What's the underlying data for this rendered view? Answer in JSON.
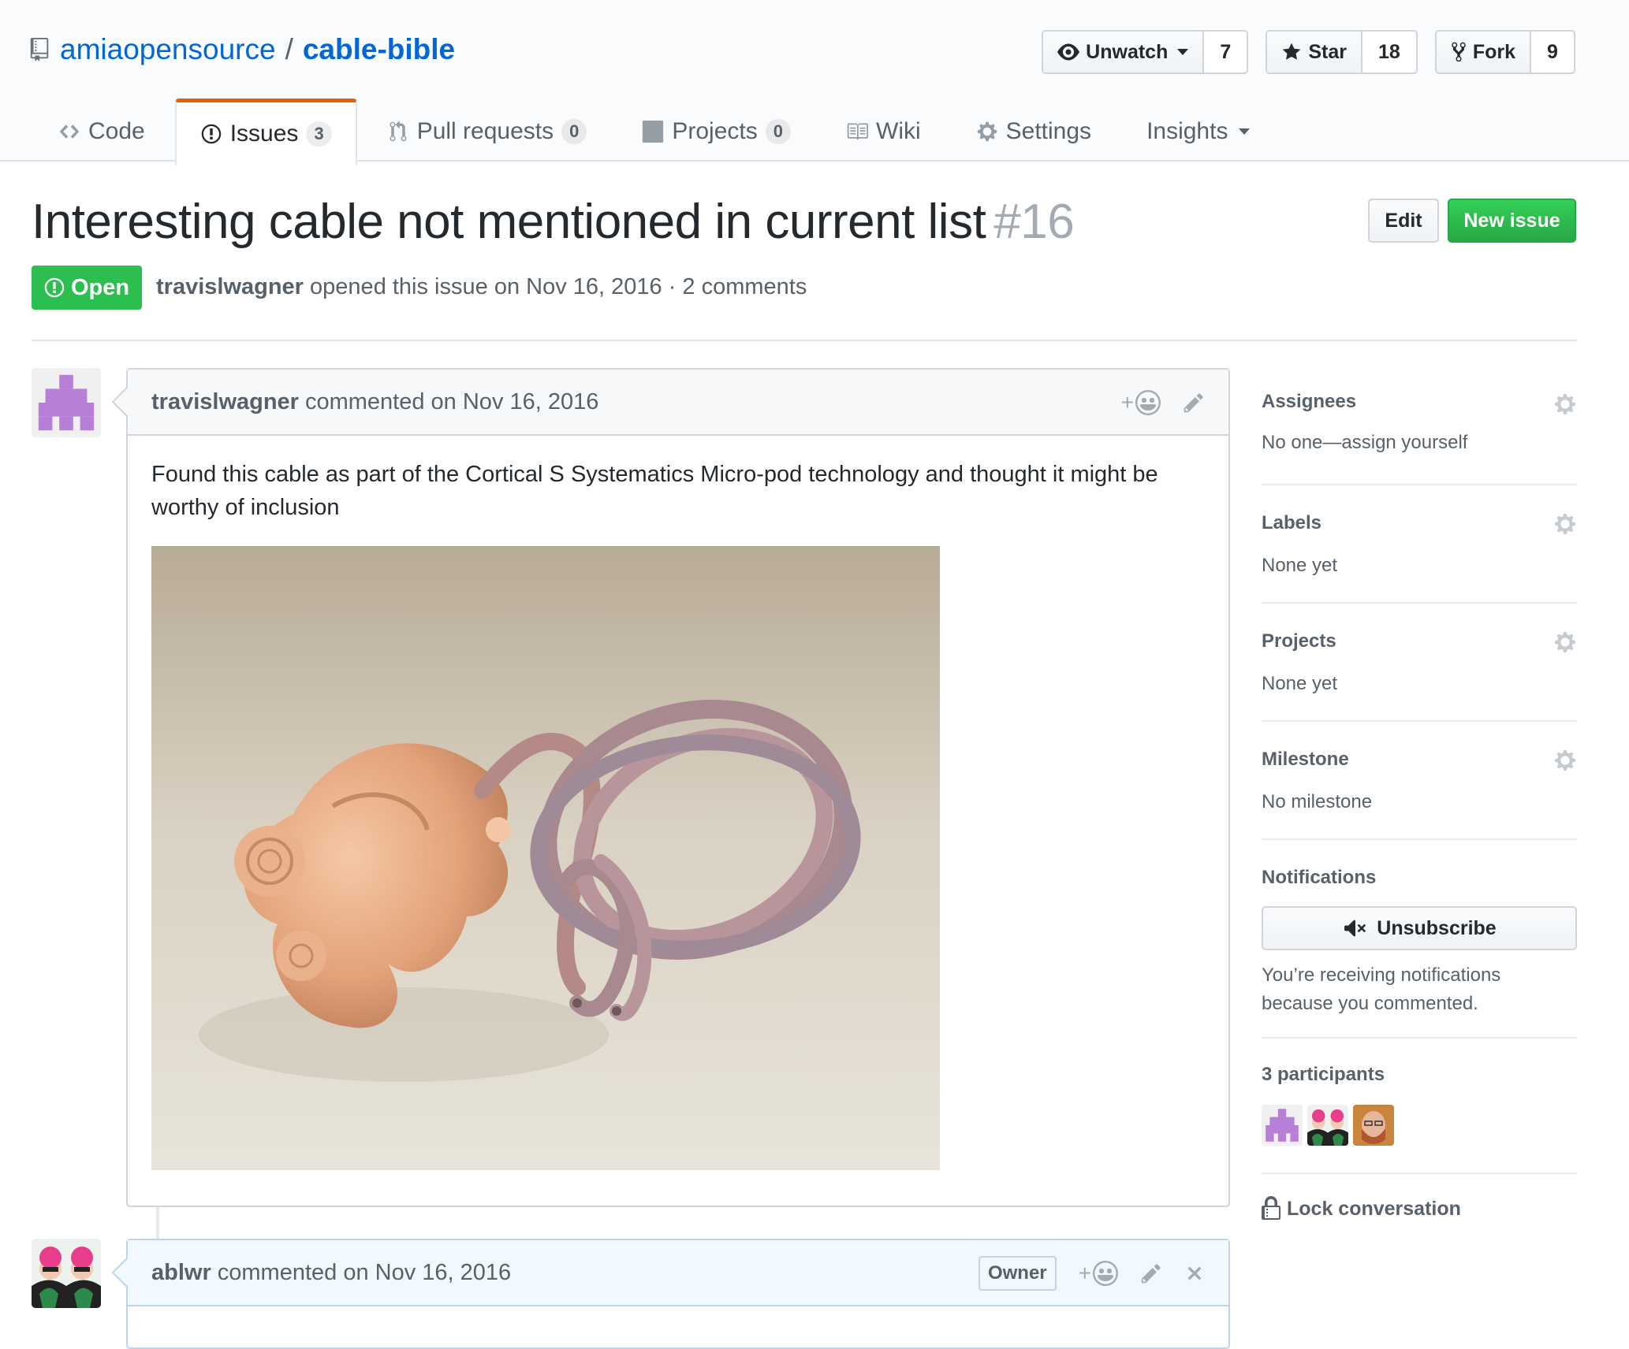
{
  "repo": {
    "owner": "amiaopensource",
    "separator": "/",
    "name": "cable-bible"
  },
  "actions": {
    "watch": {
      "label": "Unwatch",
      "count": "7"
    },
    "star": {
      "label": "Star",
      "count": "18"
    },
    "fork": {
      "label": "Fork",
      "count": "9"
    }
  },
  "nav": {
    "code": "Code",
    "issues": {
      "label": "Issues",
      "count": "3"
    },
    "pulls": {
      "label": "Pull requests",
      "count": "0"
    },
    "projects": {
      "label": "Projects",
      "count": "0"
    },
    "wiki": "Wiki",
    "settings": "Settings",
    "insights": "Insights"
  },
  "issue": {
    "title": "Interesting cable not mentioned in current list",
    "number": "#16",
    "state": "Open",
    "author": "travislwagner",
    "meta_text": "opened this issue on Nov 16, 2016 · 2 comments",
    "edit_label": "Edit",
    "new_issue_label": "New issue"
  },
  "comments": [
    {
      "author": "travislwagner",
      "meta": "commented on Nov 16, 2016",
      "body": "Found this cable as part of the Cortical S Systematics Micro-pod technology and thought it might be worthy of inclusion",
      "add_reaction": "+"
    },
    {
      "author": "ablwr",
      "meta": "commented on Nov 16, 2016",
      "badge": "Owner",
      "add_reaction": "+"
    }
  ],
  "sidebar": {
    "assignees": {
      "heading": "Assignees",
      "value": "No one—assign yourself"
    },
    "labels": {
      "heading": "Labels",
      "value": "None yet"
    },
    "projects": {
      "heading": "Projects",
      "value": "None yet"
    },
    "milestone": {
      "heading": "Milestone",
      "value": "No milestone"
    },
    "notifications": {
      "heading": "Notifications",
      "button": "Unsubscribe",
      "reason": "You’re receiving notifications because you commented."
    },
    "participants": {
      "heading": "3 participants"
    },
    "lock": "Lock conversation"
  },
  "colors": {
    "link": "#0366d6",
    "open": "#2cbe4e",
    "primary": "#28a745",
    "nav_accent": "#e36209"
  }
}
